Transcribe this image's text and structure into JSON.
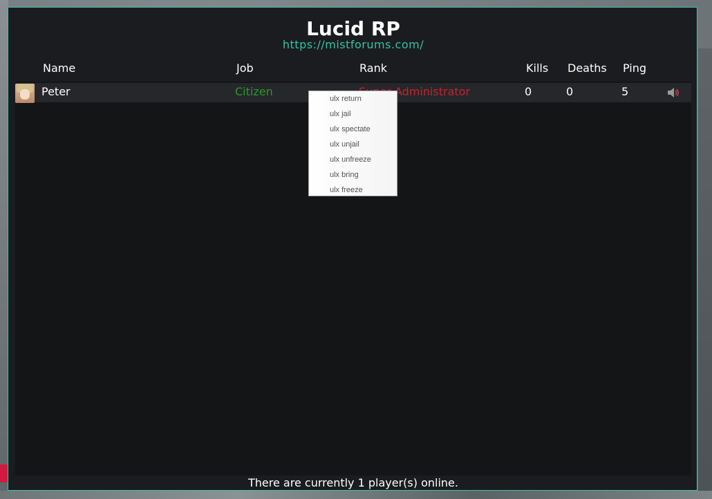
{
  "server": {
    "title": "Lucid RP",
    "url": "https://mistforums.com/"
  },
  "columns": {
    "name": "Name",
    "job": "Job",
    "rank": "Rank",
    "kills": "Kills",
    "deaths": "Deaths",
    "ping": "Ping"
  },
  "players": [
    {
      "name": "Peter",
      "job": "Citizen",
      "rank": "Super Administrator",
      "kills": "0",
      "deaths": "0",
      "ping": "5",
      "mute_icon": "speaker-icon"
    }
  ],
  "context_menu": {
    "items": [
      "ulx return",
      "ulx jail",
      "ulx spectate",
      "ulx unjail",
      "ulx unfreeze",
      "ulx bring",
      "ulx freeze"
    ]
  },
  "footer": "There are currently 1 player(s) online.",
  "colors": {
    "accent": "#37c6b3",
    "url": "#2ec4a8",
    "job_citizen": "#2a9a2a",
    "rank_superadmin": "#c4242b",
    "panel_bg": "#1b1c1f"
  }
}
